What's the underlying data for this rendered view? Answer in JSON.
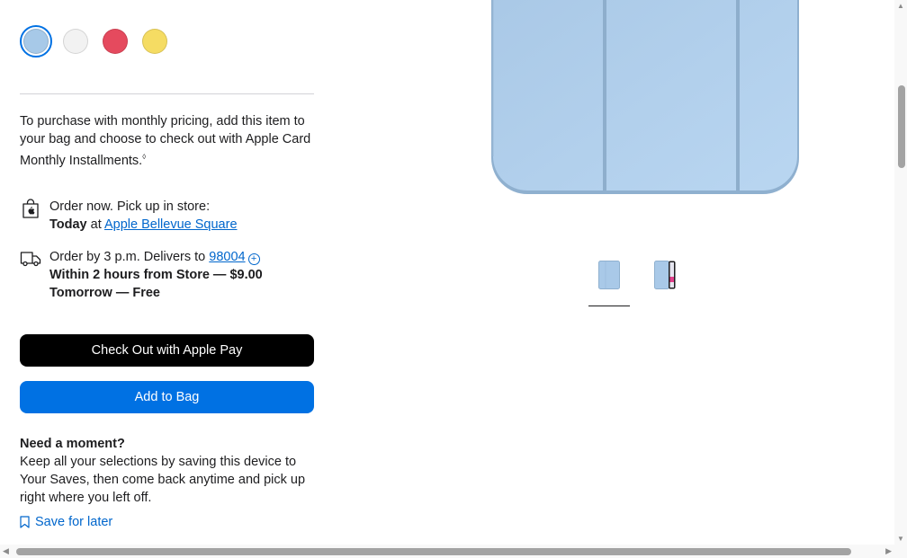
{
  "colors": {
    "swatches": [
      "#a7c9e8",
      "#f2f2f2",
      "#e54a5e",
      "#f5dc63"
    ],
    "accent": "#0071e3",
    "link": "#0066cc"
  },
  "purchase_info": {
    "text": "To purchase with monthly pricing, add this item to your bag and choose to check out with Apple Card Monthly Installments.",
    "footnote": "◊"
  },
  "pickup": {
    "icon": "apple-bag-icon",
    "line1": "Order now. Pick up in store:",
    "day": "Today",
    "at": " at ",
    "store": "Apple Bellevue Square"
  },
  "delivery": {
    "icon": "truck-icon",
    "line1_prefix": "Order by 3 p.m. Delivers to ",
    "zip": "98004",
    "option1": "Within 2 hours from Store — $9.00",
    "option2": "Tomorrow — Free"
  },
  "buttons": {
    "apple_pay": "Check Out with Apple Pay",
    "add_to_bag": "Add to Bag"
  },
  "moment": {
    "title": "Need a moment?",
    "body": "Keep all your selections by saving this device to Your Saves, then come back anytime and pick up right where you left off.",
    "save_link": "Save for later"
  }
}
